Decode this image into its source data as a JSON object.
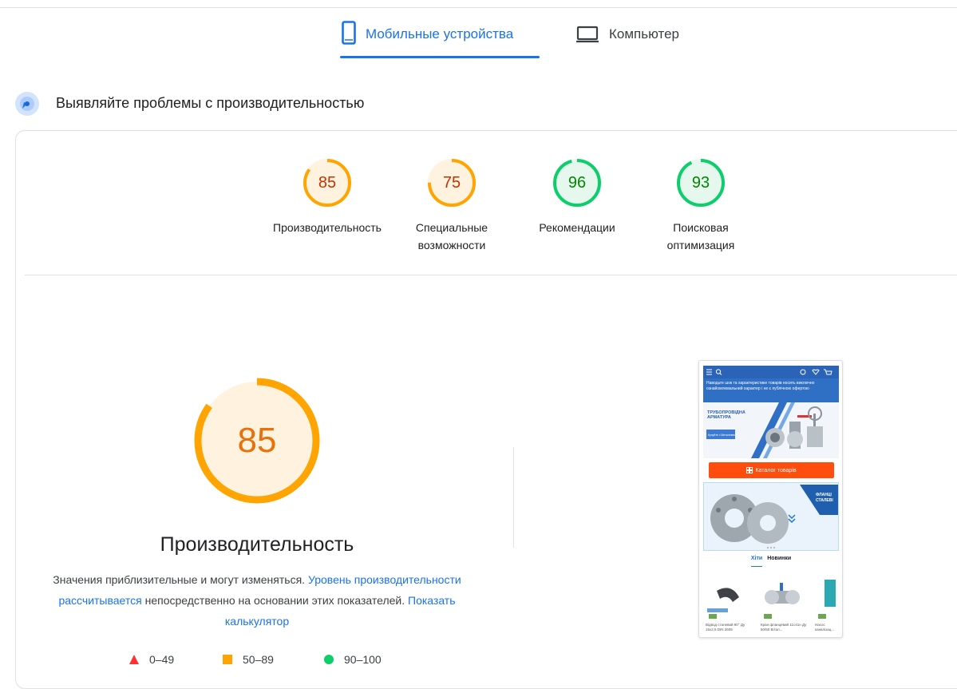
{
  "tabs": [
    {
      "label": "Мобильные устройства",
      "icon": "smartphone-icon",
      "active": true
    },
    {
      "label": "Компьютер",
      "icon": "laptop-icon",
      "active": false
    }
  ],
  "section": {
    "title": "Выявляйте проблемы с производительностью",
    "icon": "lighthouse-icon"
  },
  "scores": [
    {
      "value": "85",
      "label_line1": "Производительность",
      "label_line2": "",
      "color": "#ffa400",
      "text_color": "#c33300",
      "fill": "#fff3e0"
    },
    {
      "value": "75",
      "label_line1": "Специальные",
      "label_line2": "возможности",
      "color": "#ffa400",
      "text_color": "#c33300",
      "fill": "#fff3e0"
    },
    {
      "value": "96",
      "label_line1": "Рекомендации",
      "label_line2": "",
      "color": "#0cce6b",
      "text_color": "#008800",
      "fill": "#e6f8ee"
    },
    {
      "value": "93",
      "label_line1": "Поисковая",
      "label_line2": "оптимизация",
      "color": "#0cce6b",
      "text_color": "#008800",
      "fill": "#e6f8ee"
    }
  ],
  "main_gauge": {
    "value": "85",
    "title": "Производительность",
    "color": "#ffa400",
    "fill": "#fff3e0"
  },
  "description": {
    "text1": "Значения приблизительные и могут изменяться. ",
    "link1": "Уровень производительности рассчитывается",
    "text2": " непосредственно на основании этих показателей. ",
    "link2": "Показать калькулятор"
  },
  "legend": [
    {
      "range": "0–49",
      "shape": "triangle",
      "color": "#ff3333"
    },
    {
      "range": "50–89",
      "shape": "square",
      "color": "#ffa400"
    },
    {
      "range": "90–100",
      "shape": "circle",
      "color": "#0cce6b"
    }
  ],
  "screenshot": {
    "promo": "Наводьте шок та характеристике товарів носить виключно ознайомлювальний характер і не є публічною офертою",
    "brand_line1": "ТРУБОПРОВІДНА",
    "brand_line2": "АРМАТУРА",
    "brand_sub": "Купуйте з Металінвест",
    "catalog_button": "Каталог товарів",
    "banner_text_line1": "ФЛАНЦІ",
    "banner_text_line2": "СТАЛЕВІ",
    "tab_hits": "Хіти",
    "tab_new": "Новинки",
    "products": [
      {
        "caption": "Відвод сталевий 90° Ду 15х2,5 DIN 2605"
      },
      {
        "caption": "Кран фланцевий 11с41н Ду 50/50 Вітал..."
      },
      {
        "caption": "Насос каналізац..."
      }
    ]
  }
}
